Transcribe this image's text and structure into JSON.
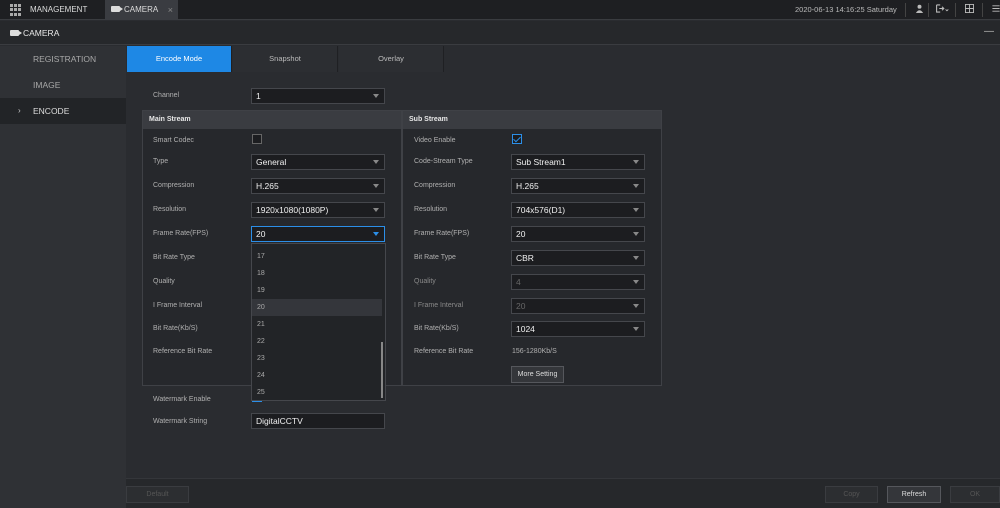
{
  "topbar": {
    "tabs": [
      {
        "label": "MANAGEMENT"
      },
      {
        "label": "CAMERA",
        "close": "×"
      }
    ],
    "datetime": "2020-06-13 14:16:25 Saturday",
    "icons": [
      "user-icon",
      "logout-icon",
      "split-screen-icon",
      "menu-icon"
    ]
  },
  "subbar": {
    "title": "CAMERA",
    "minimize": "—"
  },
  "sidebar": {
    "items": [
      {
        "label": "REGISTRATION"
      },
      {
        "label": "IMAGE"
      },
      {
        "label": "ENCODE",
        "chevron": "›"
      }
    ]
  },
  "tabs": [
    {
      "label": "Encode Mode"
    },
    {
      "label": "Snapshot"
    },
    {
      "label": "Overlay"
    }
  ],
  "channel": {
    "label": "Channel",
    "value": "1"
  },
  "main_stream": {
    "title": "Main Stream",
    "smart_codec": "Smart Codec",
    "type": {
      "label": "Type",
      "value": "General"
    },
    "compression": {
      "label": "Compression",
      "value": "H.265"
    },
    "resolution": {
      "label": "Resolution",
      "value": "1920x1080(1080P)"
    },
    "frame_rate": {
      "label": "Frame Rate(FPS)",
      "value": "20"
    },
    "bit_rate_type": {
      "label": "Bit Rate Type"
    },
    "quality": {
      "label": "Quality"
    },
    "i_frame_interval": {
      "label": "I Frame Interval"
    },
    "bit_rate": {
      "label": "Bit Rate(Kb/S)"
    },
    "reference_bit_rate": {
      "label": "Reference Bit Rate"
    }
  },
  "frame_rate_options": [
    "17",
    "18",
    "19",
    "20",
    "21",
    "22",
    "23",
    "24",
    "25"
  ],
  "sub_stream": {
    "title": "Sub Stream",
    "video_enable": "Video Enable",
    "code_stream_type": {
      "label": "Code-Stream Type",
      "value": "Sub Stream1"
    },
    "compression": {
      "label": "Compression",
      "value": "H.265"
    },
    "resolution": {
      "label": "Resolution",
      "value": "704x576(D1)"
    },
    "frame_rate": {
      "label": "Frame Rate(FPS)",
      "value": "20"
    },
    "bit_rate_type": {
      "label": "Bit Rate Type",
      "value": "CBR"
    },
    "quality": {
      "label": "Quality",
      "value": "4"
    },
    "i_frame_interval": {
      "label": "I Frame Interval",
      "value": "20"
    },
    "bit_rate": {
      "label": "Bit Rate(Kb/S)",
      "value": "1024"
    },
    "reference_bit_rate": {
      "label": "Reference Bit Rate",
      "value": "156-1280Kb/S"
    },
    "more_setting": "More Setting"
  },
  "watermark": {
    "enable_label": "Watermark Enable",
    "string_label": "Watermark String",
    "string_value": "DigitalCCTV"
  },
  "footer": {
    "default": "Default",
    "copy": "Copy",
    "refresh": "Refresh",
    "ok": "OK"
  },
  "colors": {
    "accent": "#1e88e5",
    "background": "#2a2c30"
  }
}
